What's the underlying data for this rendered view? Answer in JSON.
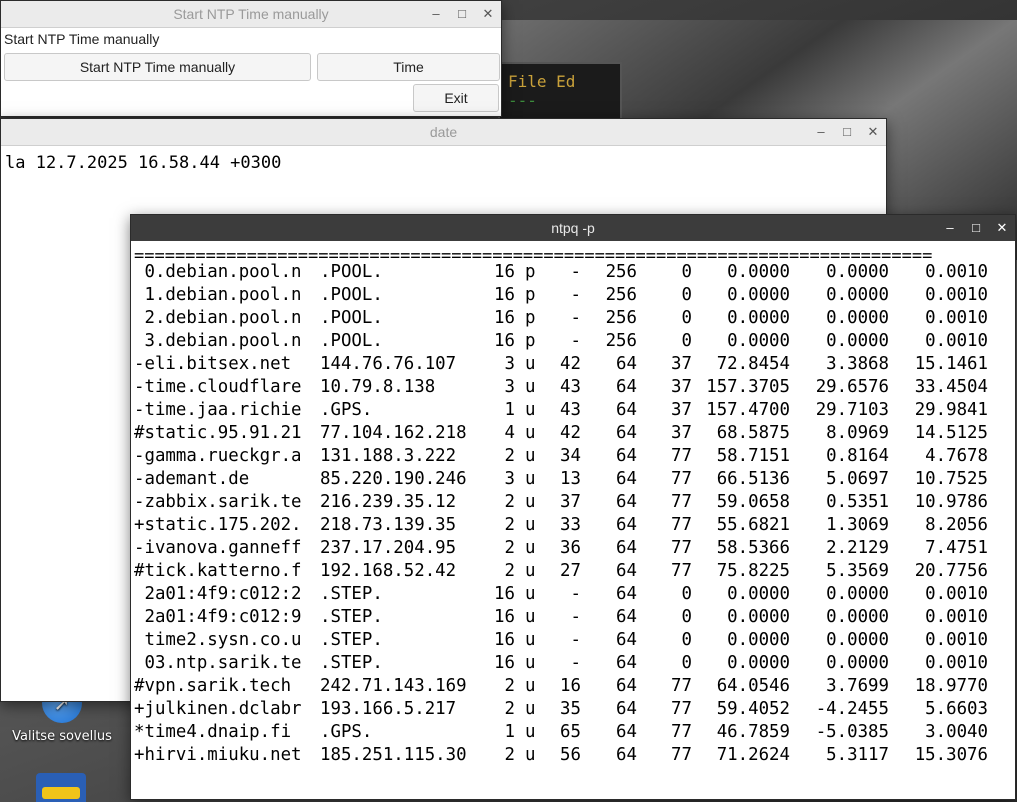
{
  "desktop": {
    "icon_label": "Valitse sovellus",
    "terminal_fragment": [
      "File Ed",
      "---"
    ]
  },
  "ntp_window": {
    "title": "Start NTP Time manually",
    "label": "Start NTP Time manually",
    "start_button": "Start NTP Time manually",
    "time_button": "Time",
    "exit_button": "Exit"
  },
  "date_window": {
    "title": "date",
    "output": "la 12.7.2025 16.58.44 +0300"
  },
  "ntpq_window": {
    "title": "ntpq -p",
    "separator": "==============================================================================",
    "rows": [
      [
        " 0.debian.pool.n",
        ".POOL.",
        "16",
        "p",
        "-",
        "256",
        "0",
        "0.0000",
        "0.0000",
        "0.0010"
      ],
      [
        " 1.debian.pool.n",
        ".POOL.",
        "16",
        "p",
        "-",
        "256",
        "0",
        "0.0000",
        "0.0000",
        "0.0010"
      ],
      [
        " 2.debian.pool.n",
        ".POOL.",
        "16",
        "p",
        "-",
        "256",
        "0",
        "0.0000",
        "0.0000",
        "0.0010"
      ],
      [
        " 3.debian.pool.n",
        ".POOL.",
        "16",
        "p",
        "-",
        "256",
        "0",
        "0.0000",
        "0.0000",
        "0.0010"
      ],
      [
        "-eli.bitsex.net",
        "144.76.76.107",
        "3",
        "u",
        "42",
        "64",
        "37",
        "72.8454",
        "3.3868",
        "15.1461"
      ],
      [
        "-time.cloudflare",
        "10.79.8.138",
        "3",
        "u",
        "43",
        "64",
        "37",
        "157.3705",
        "29.6576",
        "33.4504"
      ],
      [
        "-time.jaa.richie",
        ".GPS.",
        "1",
        "u",
        "43",
        "64",
        "37",
        "157.4700",
        "29.7103",
        "29.9841"
      ],
      [
        "#static.95.91.21",
        "77.104.162.218",
        "4",
        "u",
        "42",
        "64",
        "37",
        "68.5875",
        "8.0969",
        "14.5125"
      ],
      [
        "-gamma.rueckgr.a",
        "131.188.3.222",
        "2",
        "u",
        "34",
        "64",
        "77",
        "58.7151",
        "0.8164",
        "4.7678"
      ],
      [
        "-ademant.de",
        "85.220.190.246",
        "3",
        "u",
        "13",
        "64",
        "77",
        "66.5136",
        "5.0697",
        "10.7525"
      ],
      [
        "-zabbix.sarik.te",
        "216.239.35.12",
        "2",
        "u",
        "37",
        "64",
        "77",
        "59.0658",
        "0.5351",
        "10.9786"
      ],
      [
        "+static.175.202.",
        "218.73.139.35",
        "2",
        "u",
        "33",
        "64",
        "77",
        "55.6821",
        "1.3069",
        "8.2056"
      ],
      [
        "-ivanova.ganneff",
        "237.17.204.95",
        "2",
        "u",
        "36",
        "64",
        "77",
        "58.5366",
        "2.2129",
        "7.4751"
      ],
      [
        "#tick.katterno.f",
        "192.168.52.42",
        "2",
        "u",
        "27",
        "64",
        "77",
        "75.8225",
        "5.3569",
        "20.7756"
      ],
      [
        " 2a01:4f9:c012:2",
        ".STEP.",
        "16",
        "u",
        "-",
        "64",
        "0",
        "0.0000",
        "0.0000",
        "0.0010"
      ],
      [
        " 2a01:4f9:c012:9",
        ".STEP.",
        "16",
        "u",
        "-",
        "64",
        "0",
        "0.0000",
        "0.0000",
        "0.0010"
      ],
      [
        " time2.sysn.co.u",
        ".STEP.",
        "16",
        "u",
        "-",
        "64",
        "0",
        "0.0000",
        "0.0000",
        "0.0010"
      ],
      [
        " 03.ntp.sarik.te",
        ".STEP.",
        "16",
        "u",
        "-",
        "64",
        "0",
        "0.0000",
        "0.0000",
        "0.0010"
      ],
      [
        "#vpn.sarik.tech",
        "242.71.143.169",
        "2",
        "u",
        "16",
        "64",
        "77",
        "64.0546",
        "3.7699",
        "18.9770"
      ],
      [
        "+julkinen.dclabr",
        "193.166.5.217",
        "2",
        "u",
        "35",
        "64",
        "77",
        "59.4052",
        "-4.2455",
        "5.6603"
      ],
      [
        "*time4.dnaip.fi",
        ".GPS.",
        "1",
        "u",
        "65",
        "64",
        "77",
        "46.7859",
        "-5.0385",
        "3.0040"
      ],
      [
        "+hirvi.miuku.net",
        "185.251.115.30",
        "2",
        "u",
        "56",
        "64",
        "77",
        "71.2624",
        "5.3117",
        "15.3076"
      ]
    ]
  },
  "window_controls": {
    "minimize": "–",
    "maximize": "□",
    "close": "✕"
  }
}
